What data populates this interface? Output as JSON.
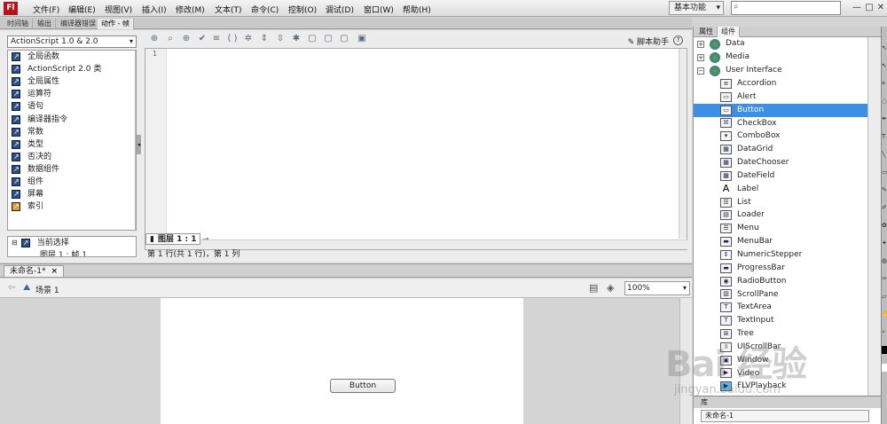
{
  "menubar": {
    "logo": "Fl",
    "items": [
      "文件(F)",
      "编辑(E)",
      "视图(V)",
      "插入(I)",
      "修改(M)",
      "文本(T)",
      "命令(C)",
      "控制(O)",
      "调试(D)",
      "窗口(W)",
      "帮助(H)"
    ],
    "workspace": "基本功能",
    "search_icon": "search-icon",
    "window_buttons": [
      "—",
      "□",
      "✕"
    ]
  },
  "panel_tabs": [
    "时间轴",
    "输出",
    "编译器错误",
    "动作 - 帧"
  ],
  "actions": {
    "version": "ActionScript 1.0 & 2.0",
    "tree_items": [
      "全局函数",
      "ActionScript 2.0 类",
      "全局属性",
      "运算符",
      "语句",
      "编译器指令",
      "常数",
      "类型",
      "否决的",
      "数据组件",
      "组件",
      "屏幕",
      "索引"
    ],
    "lower_tree": [
      "当前选择",
      "图层 1 : 帧 1"
    ],
    "script_helper": "脚本助手",
    "help": "?",
    "line_number": "1",
    "layer_tab": "图层 1 : 1",
    "status": "第 1 行(共 1 行)，第 1 列"
  },
  "document": {
    "tab": "未命名-1*",
    "close": "×",
    "scene": "场景 1",
    "zoom": "100%",
    "stage_button": "Button"
  },
  "right_panel": {
    "tabs": [
      "属性",
      "组件"
    ],
    "categories": [
      {
        "label": "Data",
        "expanded": false
      },
      {
        "label": "Media",
        "expanded": false
      },
      {
        "label": "User Interface",
        "expanded": true
      }
    ],
    "components": [
      "Accordion",
      "Alert",
      "Button",
      "CheckBox",
      "ComboBox",
      "DataGrid",
      "DateChooser",
      "DateField",
      "Label",
      "List",
      "Loader",
      "Menu",
      "MenuBar",
      "NumericStepper",
      "ProgressBar",
      "RadioButton",
      "ScrollPane",
      "TextArea",
      "TextInput",
      "Tree",
      "UIScrollBar",
      "Window",
      "Video",
      "FLVPlayback"
    ],
    "selected_component": "Button",
    "library_header": "库",
    "library_doc": "未命名-1"
  },
  "watermark": {
    "text": "Bai 经验",
    "url": "jingyan.baidu.com"
  },
  "colors": {
    "selection": "#3d8fe3",
    "logo_bg": "#b5121b"
  }
}
